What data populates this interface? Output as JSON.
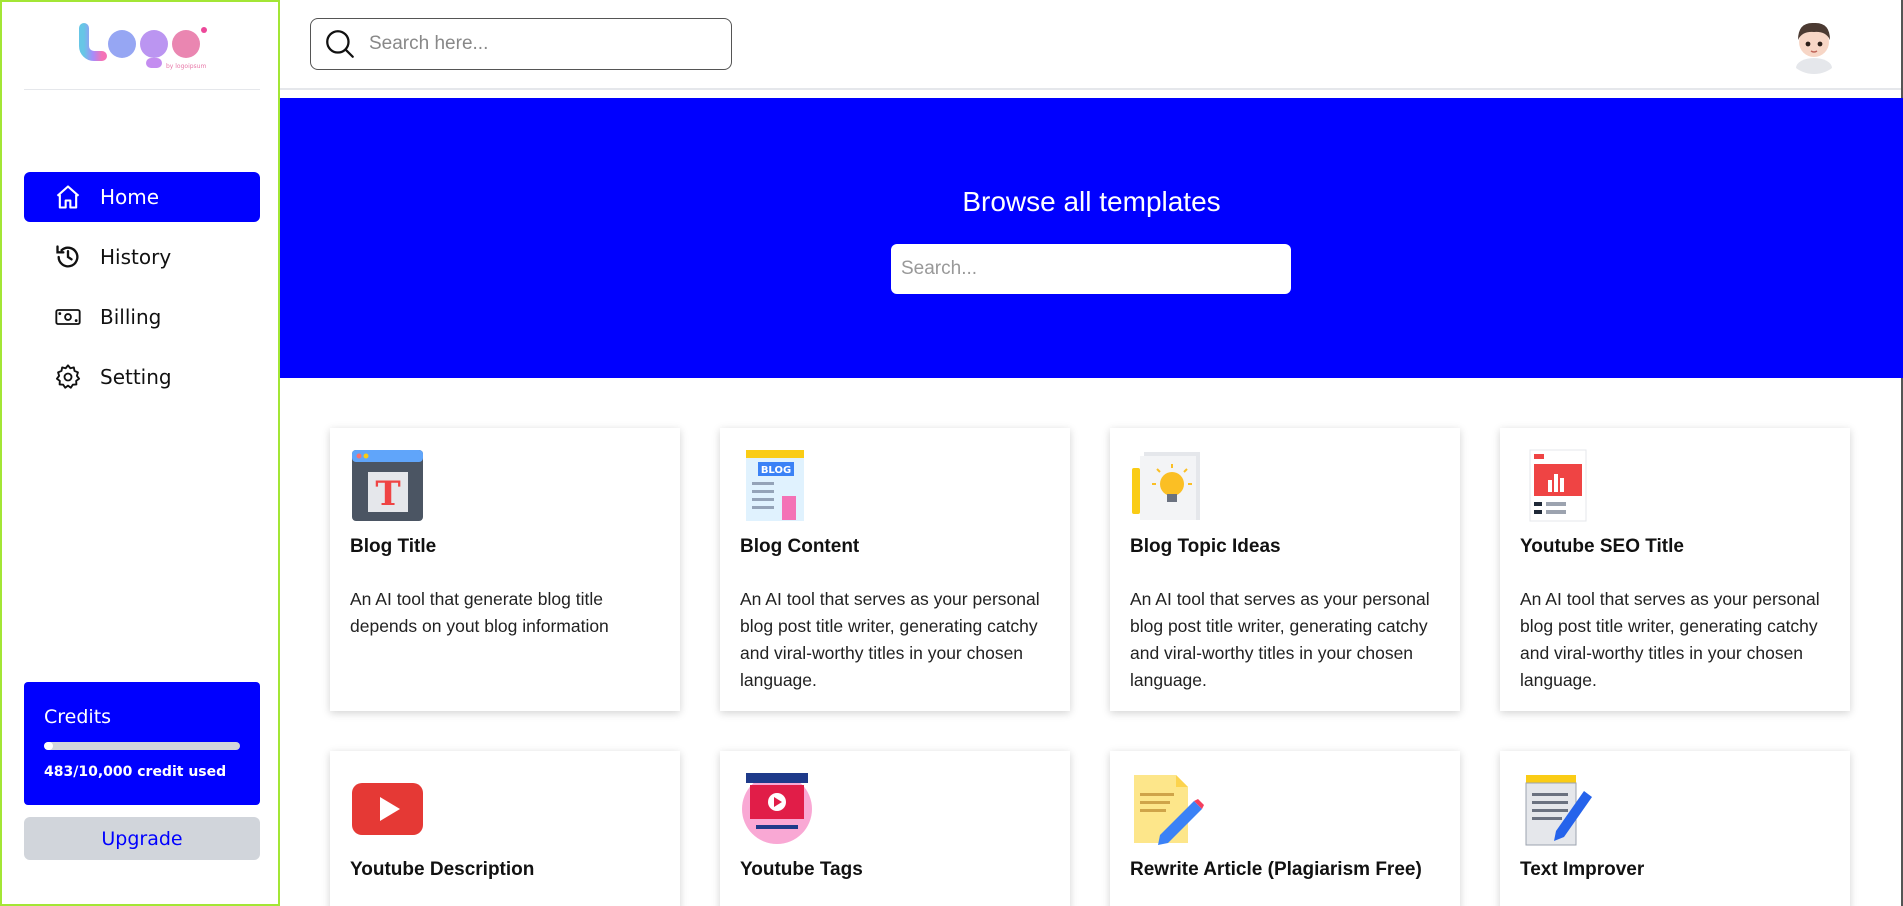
{
  "sidebar": {
    "nav": [
      {
        "label": "Home",
        "icon": "home-icon",
        "active": true
      },
      {
        "label": "History",
        "icon": "history-icon",
        "active": false
      },
      {
        "label": "Billing",
        "icon": "billing-icon",
        "active": false
      },
      {
        "label": "Setting",
        "icon": "gear-icon",
        "active": false
      }
    ],
    "credits": {
      "title": "Credits",
      "used_text": "483/10,000 credit used",
      "used_fraction": 0.0483
    },
    "upgrade_label": "Upgrade"
  },
  "header": {
    "search_placeholder": "Search here..."
  },
  "banner": {
    "title": "Browse all templates",
    "search_placeholder": "Search..."
  },
  "templates": [
    {
      "title": "Blog Title",
      "desc": "An AI tool that generate blog title depends on yout blog information",
      "icon": "blog-title-icon"
    },
    {
      "title": "Blog Content",
      "desc": "An AI tool that serves as your personal blog post title writer, generating catchy and viral-worthy titles in your chosen language.",
      "icon": "blog-content-icon"
    },
    {
      "title": "Blog Topic Ideas",
      "desc": "An AI tool that serves as your personal blog post title writer, generating catchy and viral-worthy titles in your chosen language.",
      "icon": "lightbulb-icon"
    },
    {
      "title": "Youtube SEO Title",
      "desc": "An AI tool that serves as your personal blog post title writer, generating catchy and viral-worthy titles in your chosen language.",
      "icon": "youtube-seo-icon"
    },
    {
      "title": "Youtube Description",
      "desc": "",
      "icon": "youtube-icon"
    },
    {
      "title": "Youtube Tags",
      "desc": "",
      "icon": "video-tags-icon"
    },
    {
      "title": "Rewrite Article (Plagiarism Free)",
      "desc": "",
      "icon": "rewrite-icon"
    },
    {
      "title": "Text Improver",
      "desc": "",
      "icon": "notepad-pen-icon"
    }
  ],
  "colors": {
    "primary": "#0000ff",
    "sidebar_border": "#a3e635",
    "upgrade_bg": "#d1d5db"
  }
}
